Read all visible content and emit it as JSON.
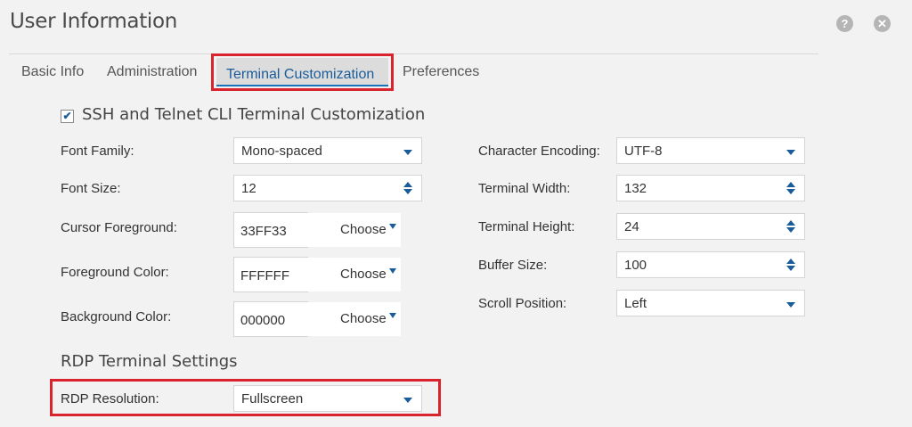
{
  "dialog": {
    "title": "User Information",
    "help_icon": "?",
    "close_icon": "✕"
  },
  "tabs": [
    {
      "label": "Basic Info",
      "active": false
    },
    {
      "label": "Administration",
      "active": false
    },
    {
      "label": "Terminal Customization",
      "active": true
    },
    {
      "label": "Preferences",
      "active": false
    }
  ],
  "ssh_section": {
    "checkbox_checked": true,
    "checkbox_glyph": "✔",
    "title": "SSH and Telnet CLI Terminal Customization",
    "font_family": {
      "label": "Font Family:",
      "value": "Mono-spaced"
    },
    "font_size": {
      "label": "Font Size:",
      "value": "12"
    },
    "cursor_foreground": {
      "label": "Cursor Foreground:",
      "value": "33FF33",
      "button": "Choose"
    },
    "foreground_color": {
      "label": "Foreground Color:",
      "value": "FFFFFF",
      "button": "Choose"
    },
    "background_color": {
      "label": "Background Color:",
      "value": "000000",
      "button": "Choose"
    },
    "character_encoding": {
      "label": "Character Encoding:",
      "value": "UTF-8"
    },
    "terminal_width": {
      "label": "Terminal Width:",
      "value": "132"
    },
    "terminal_height": {
      "label": "Terminal Height:",
      "value": "24"
    },
    "buffer_size": {
      "label": "Buffer Size:",
      "value": "100"
    },
    "scroll_position": {
      "label": "Scroll Position:",
      "value": "Left"
    }
  },
  "rdp_section": {
    "title": "RDP Terminal Settings",
    "rdp_resolution": {
      "label": "RDP Resolution:",
      "value": "Fullscreen"
    }
  },
  "colors": {
    "highlight": "#d9232d",
    "accent": "#1a5c9a",
    "background": "#f2f2f2"
  }
}
